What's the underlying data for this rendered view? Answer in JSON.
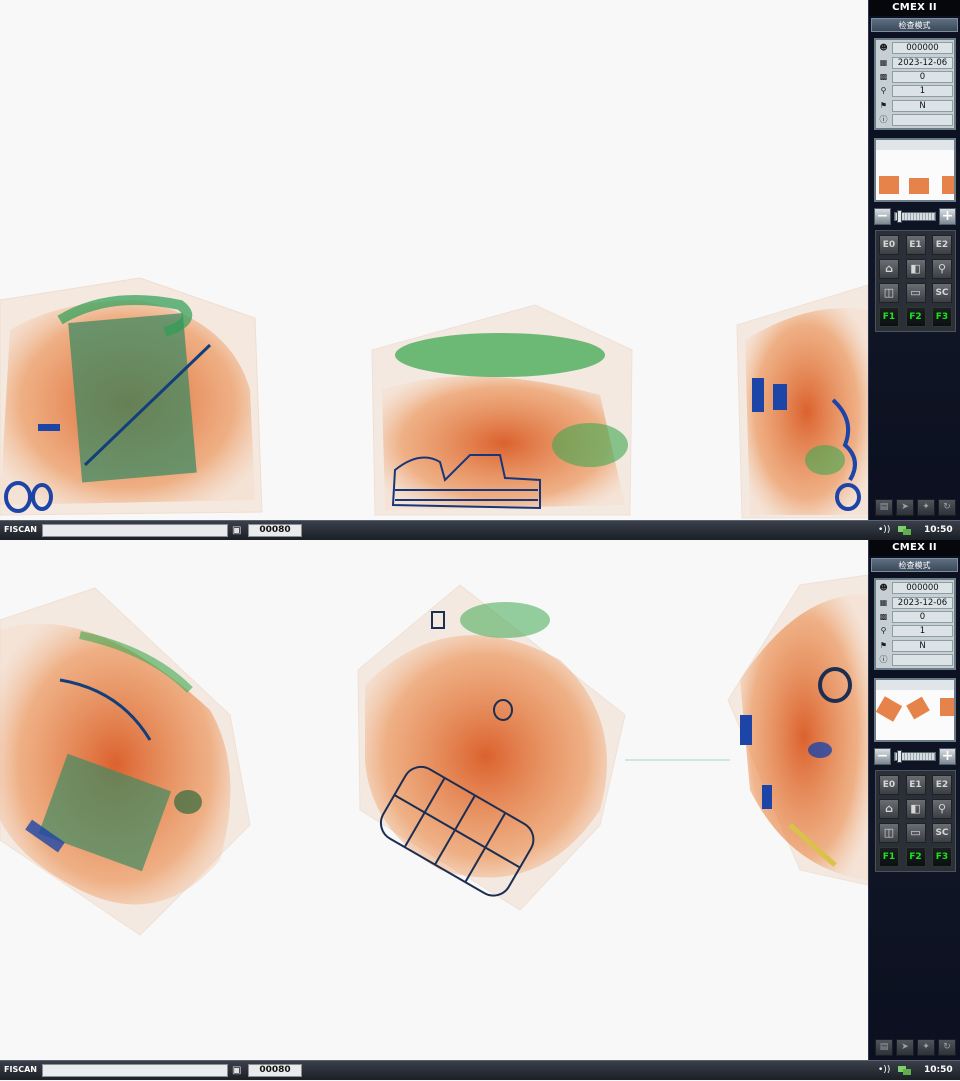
{
  "screens": [
    {
      "sidebar": {
        "brand": "CMEX II",
        "mode": "检查模式",
        "info": {
          "operator_id": "000000",
          "date": "2023-12-06",
          "count": "0",
          "zoom": "1",
          "flag": "N",
          "note": ""
        },
        "buttons": [
          "E0",
          "E1",
          "E2",
          "⌂",
          "◧",
          "⚲",
          "◫",
          "▭",
          "SC",
          "F1",
          "F2",
          "F3"
        ]
      },
      "status": {
        "brand": "FISCAN",
        "field": "",
        "bag_count": "00080",
        "time": "10:50",
        "sound_icon": "•))"
      }
    },
    {
      "sidebar": {
        "brand": "CMEX II",
        "mode": "检查模式",
        "info": {
          "operator_id": "000000",
          "date": "2023-12-06",
          "count": "0",
          "zoom": "1",
          "flag": "N",
          "note": ""
        },
        "buttons": [
          "E0",
          "E1",
          "E2",
          "⌂",
          "◧",
          "⚲",
          "◫",
          "▭",
          "SC",
          "F1",
          "F2",
          "F3"
        ]
      },
      "status": {
        "brand": "FISCAN",
        "field": "",
        "bag_count": "00080",
        "time": "10:50",
        "sound_icon": "•))"
      }
    }
  ],
  "icons": {
    "operator": "user-icon",
    "date": "calendar-icon",
    "count": "counter-icon",
    "zoom": "magnifier-icon",
    "flag": "flag-icon",
    "info": "info-icon"
  },
  "colors": {
    "organic": "#e0651f",
    "inorganic": "#3fa852",
    "metal": "#1d45a8",
    "sidebar_bg": "#0b0f1f"
  }
}
